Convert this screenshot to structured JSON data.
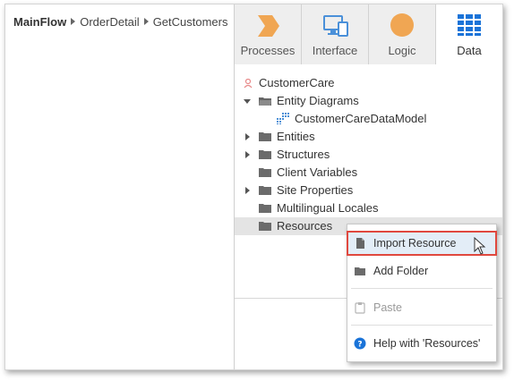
{
  "breadcrumb": {
    "items": [
      "MainFlow",
      "OrderDetail",
      "GetCustomers"
    ]
  },
  "tabs": [
    {
      "label": "Processes",
      "icon": "processes-icon",
      "color": "#f0a653"
    },
    {
      "label": "Interface",
      "icon": "interface-icon",
      "color": "#4a90d9"
    },
    {
      "label": "Logic",
      "icon": "logic-icon",
      "color": "#f0a653"
    },
    {
      "label": "Data",
      "icon": "data-icon",
      "color": "#1a73d8"
    }
  ],
  "tree": {
    "root": "CustomerCare",
    "items": [
      {
        "label": "Entity Diagrams",
        "state": "expanded"
      },
      {
        "label": "CustomerCareDataModel",
        "state": "leaf"
      },
      {
        "label": "Entities",
        "state": "collapsed"
      },
      {
        "label": "Structures",
        "state": "collapsed"
      },
      {
        "label": "Client Variables",
        "state": "leaf"
      },
      {
        "label": "Site Properties",
        "state": "collapsed"
      },
      {
        "label": "Multilingual Locales",
        "state": "leaf"
      },
      {
        "label": "Resources",
        "state": "selected"
      }
    ]
  },
  "context_menu": {
    "items": [
      {
        "label": "Import Resource",
        "icon": "file-icon",
        "highlighted": true
      },
      {
        "label": "Add Folder",
        "icon": "folder-icon"
      },
      {
        "label": "Paste",
        "icon": "clipboard-icon",
        "disabled": true
      },
      {
        "label": "Help with 'Resources'",
        "icon": "help-icon"
      }
    ]
  },
  "colors": {
    "highlight_border": "#e0483e",
    "selection_bg": "#e4e4e4",
    "accent": "#1a73d8"
  }
}
